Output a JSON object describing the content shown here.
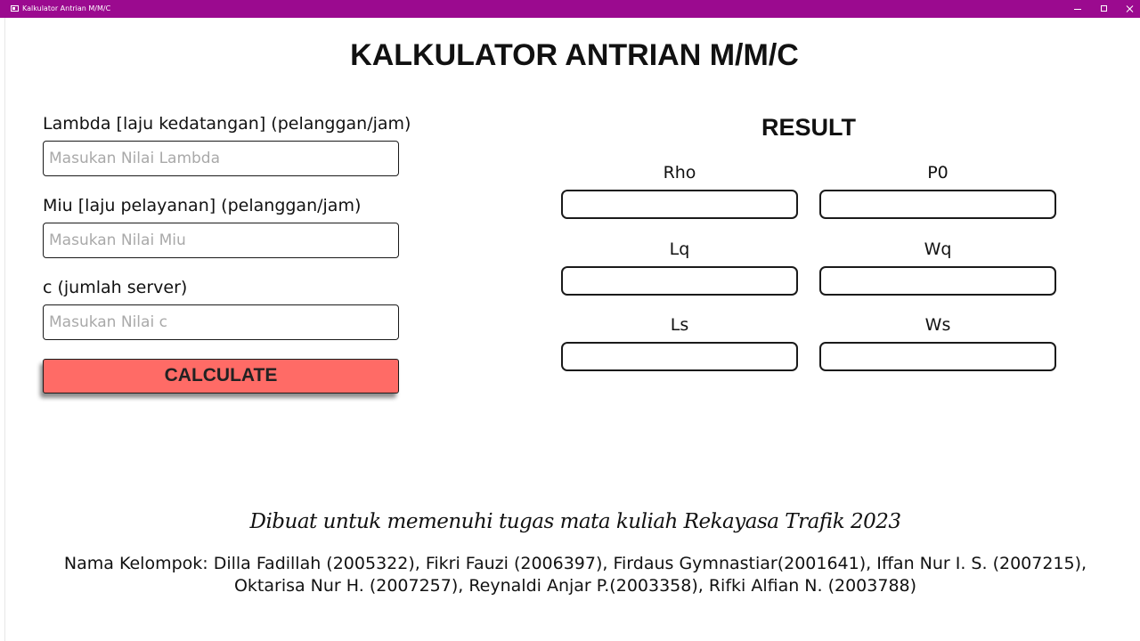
{
  "window": {
    "title": "Kalkulator Antrian M/M/C"
  },
  "header": {
    "title": "KALKULATOR ANTRIAN M/M/C"
  },
  "inputs": {
    "lambda": {
      "label": "Lambda [laju kedatangan] (pelanggan/jam)",
      "placeholder": "Masukan Nilai Lambda",
      "value": ""
    },
    "miu": {
      "label": "Miu [laju pelayanan] (pelanggan/jam)",
      "placeholder": "Masukan Nilai Miu",
      "value": ""
    },
    "c": {
      "label": "c (jumlah server)",
      "placeholder": "Masukan Nilai c",
      "value": ""
    }
  },
  "calculate_button": {
    "label": "CALCULATE"
  },
  "result": {
    "title": "RESULT",
    "rho": {
      "label": "Rho",
      "value": ""
    },
    "p0": {
      "label": "P0",
      "value": ""
    },
    "lq": {
      "label": "Lq",
      "value": ""
    },
    "wq": {
      "label": "Wq",
      "value": ""
    },
    "ls": {
      "label": "Ls",
      "value": ""
    },
    "ws": {
      "label": "Ws",
      "value": ""
    }
  },
  "footer": {
    "course_note": "Dibuat untuk memenuhi tugas mata kuliah Rekayasa Trafik 2023",
    "members_line1": "Nama Kelompok: Dilla Fadillah (2005322), Fikri Fauzi (2006397), Firdaus Gymnastiar(2001641), Iffan Nur I. S. (2007215),",
    "members_line2": "Oktarisa Nur H. (2007257), Reynaldi Anjar P.(2003358), Rifki Alfian N. (2003788)"
  },
  "colors": {
    "titlebar": "#9b0a8f",
    "calculate_button": "#ff6b66"
  },
  "icons": {
    "app": "app-window-icon",
    "minimize": "minimize-icon",
    "maximize": "maximize-icon",
    "close": "close-icon"
  }
}
